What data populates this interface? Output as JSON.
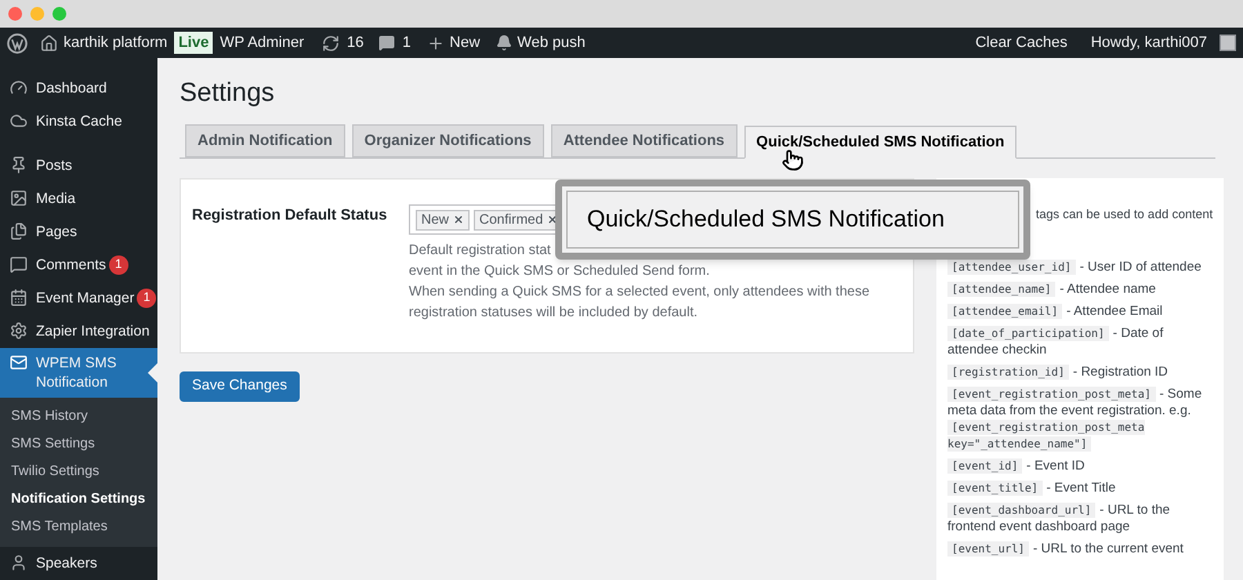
{
  "admin_bar": {
    "site": "karthik platform",
    "env_badge": "Live",
    "adminer": "WP Adminer",
    "updates": "16",
    "comments": "1",
    "new": "New",
    "web_push": "Web push",
    "clear_caches": "Clear Caches",
    "howdy": "Howdy, karthi007"
  },
  "sidebar": {
    "items": [
      {
        "kind": "dashboard",
        "label": "Dashboard",
        "selected": false
      },
      {
        "kind": "cloud",
        "label": "Kinsta Cache",
        "selected": false
      },
      {
        "kind": "pin",
        "label": "Posts",
        "selected": false
      },
      {
        "kind": "media",
        "label": "Media",
        "selected": false
      },
      {
        "kind": "pages",
        "label": "Pages",
        "selected": false
      },
      {
        "kind": "comment",
        "label": "Comments",
        "badge": "1",
        "selected": false
      },
      {
        "kind": "calendar",
        "label": "Event Manager",
        "badge": "1",
        "selected": false
      },
      {
        "kind": "gear",
        "label": "Zapier Integration",
        "selected": false
      },
      {
        "kind": "mail",
        "label": "WPEM SMS Notification",
        "selected": true,
        "children": [
          {
            "label": "SMS History",
            "selected": false
          },
          {
            "label": "SMS Settings",
            "selected": false
          },
          {
            "label": "Twilio Settings",
            "selected": false
          },
          {
            "label": "Notification Settings",
            "selected": true
          },
          {
            "label": "SMS Templates",
            "selected": false
          }
        ]
      },
      {
        "kind": "person",
        "label": "Speakers",
        "selected": false
      }
    ]
  },
  "page_title": "Settings",
  "tabs": [
    {
      "label": "Admin Notification",
      "selected": false
    },
    {
      "label": "Organizer Notifications",
      "selected": false
    },
    {
      "label": "Attendee Notifications",
      "selected": false
    },
    {
      "label": "Quick/Scheduled SMS Notification",
      "selected": true
    }
  ],
  "setting": {
    "label": "Registration Default Status",
    "tags": [
      "New",
      "Confirmed"
    ],
    "description_lines": [
      "Default registration stat",
      "event in the Quick SMS or Scheduled Send form.",
      "When sending a Quick SMS for a selected event, only attendees with these",
      "registration statuses will be included by default."
    ]
  },
  "save_button": "Save Changes",
  "callout": "Quick/Scheduled SMS Notification",
  "tags_panel": {
    "intro": "tags can be used to add content",
    "items": [
      {
        "parts": [
          {
            "kind": "code",
            "text": "[attendee_user_id]"
          },
          {
            "kind": "text",
            "text": "- User ID of attendee"
          }
        ]
      },
      {
        "parts": [
          {
            "kind": "code",
            "text": "[attendee_name]"
          },
          {
            "kind": "text",
            "text": "- Attendee name"
          }
        ]
      },
      {
        "parts": [
          {
            "kind": "code",
            "text": "[attendee_email]"
          },
          {
            "kind": "text",
            "text": "- Attendee Email"
          }
        ]
      },
      {
        "parts": [
          {
            "kind": "code",
            "text": "[date_of_participation]"
          },
          {
            "kind": "text",
            "text": "- Date of attendee checkin"
          }
        ]
      },
      {
        "parts": [
          {
            "kind": "code",
            "text": "[registration_id]"
          },
          {
            "kind": "text",
            "text": "- Registration ID"
          }
        ]
      },
      {
        "parts": [
          {
            "kind": "code",
            "text": "[event_registration_post_meta]"
          },
          {
            "kind": "text",
            "text": "- Some meta data from the event registration. e.g."
          },
          {
            "kind": "code",
            "text": "[event_registration_post_meta key=\"_attendee_name\"]"
          }
        ]
      },
      {
        "parts": [
          {
            "kind": "code",
            "text": "[event_id]"
          },
          {
            "kind": "text",
            "text": "- Event ID"
          }
        ]
      },
      {
        "parts": [
          {
            "kind": "code",
            "text": "[event_title]"
          },
          {
            "kind": "text",
            "text": "- Event Title"
          }
        ]
      },
      {
        "parts": [
          {
            "kind": "code",
            "text": "[event_dashboard_url]"
          },
          {
            "kind": "text",
            "text": "- URL to the frontend event dashboard page"
          }
        ]
      },
      {
        "parts": [
          {
            "kind": "code",
            "text": "[event_url]"
          },
          {
            "kind": "text",
            "text": "- URL to the current event"
          }
        ]
      }
    ]
  }
}
